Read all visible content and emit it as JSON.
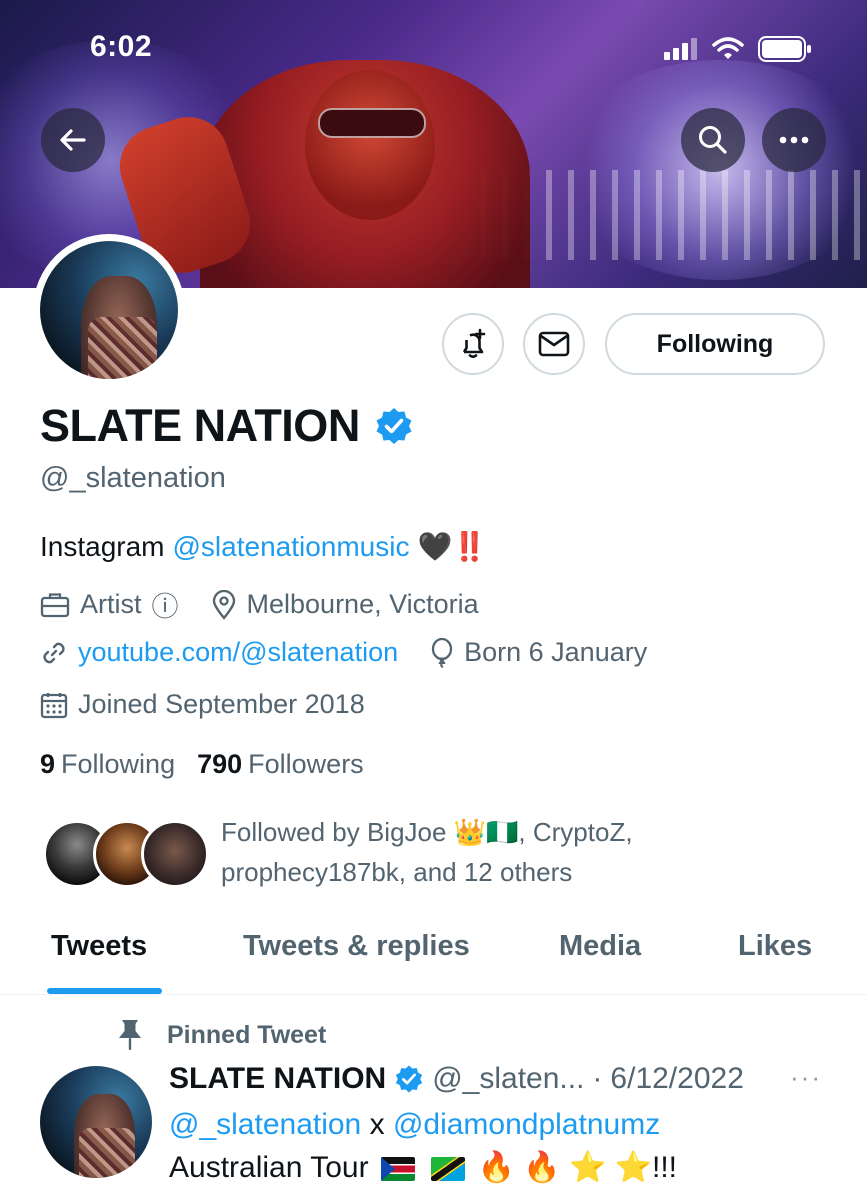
{
  "status_bar": {
    "time": "6:02"
  },
  "profile": {
    "display_name": "SLATE NATION",
    "handle": "@_slatenation",
    "bio_prefix": "Instagram",
    "bio_link": "@slatenationmusic",
    "bio_emojis": "🖤‼️",
    "category": "Artist",
    "info_glyph": "ⓘ",
    "location": "Melbourne, Victoria",
    "website": "youtube.com/@slatenation",
    "birthday": "Born 6 January",
    "joined": "Joined September 2018",
    "following_count": "9",
    "following_label": "Following",
    "followers_count": "790",
    "followers_label": "Followers",
    "followed_by_line1": "Followed by BigJoe 👑🇳🇬, CryptoZ,",
    "followed_by_line2": "prophecy187bk, and 12 others",
    "follow_button_label": "Following"
  },
  "tabs": [
    {
      "label": "Tweets"
    },
    {
      "label": "Tweets & replies"
    },
    {
      "label": "Media"
    },
    {
      "label": "Likes"
    }
  ],
  "pinned_tweet": {
    "pinned_label": "Pinned Tweet",
    "author_name": "SLATE NATION",
    "author_handle": "@_slaten...",
    "separator": "·",
    "date": "6/12/2022",
    "more": "···",
    "mention1": "@_slatenation",
    "joiner": "x",
    "mention2": "@diamondplatnumz",
    "line2_text": "Australian Tour",
    "line2_emojis": "🔥 🔥 ⭐ ⭐",
    "line2_suffix": "!!!"
  },
  "colors": {
    "accent": "#1d9bf0",
    "text": "#0f1419",
    "muted": "#536471",
    "border": "#cfd9de"
  },
  "icons": [
    "back-arrow-icon",
    "search-icon",
    "more-icon",
    "notification-add-icon",
    "mail-icon",
    "verified-icon",
    "briefcase-icon",
    "location-icon",
    "link-icon",
    "balloon-icon",
    "calendar-icon",
    "pin-icon"
  ]
}
